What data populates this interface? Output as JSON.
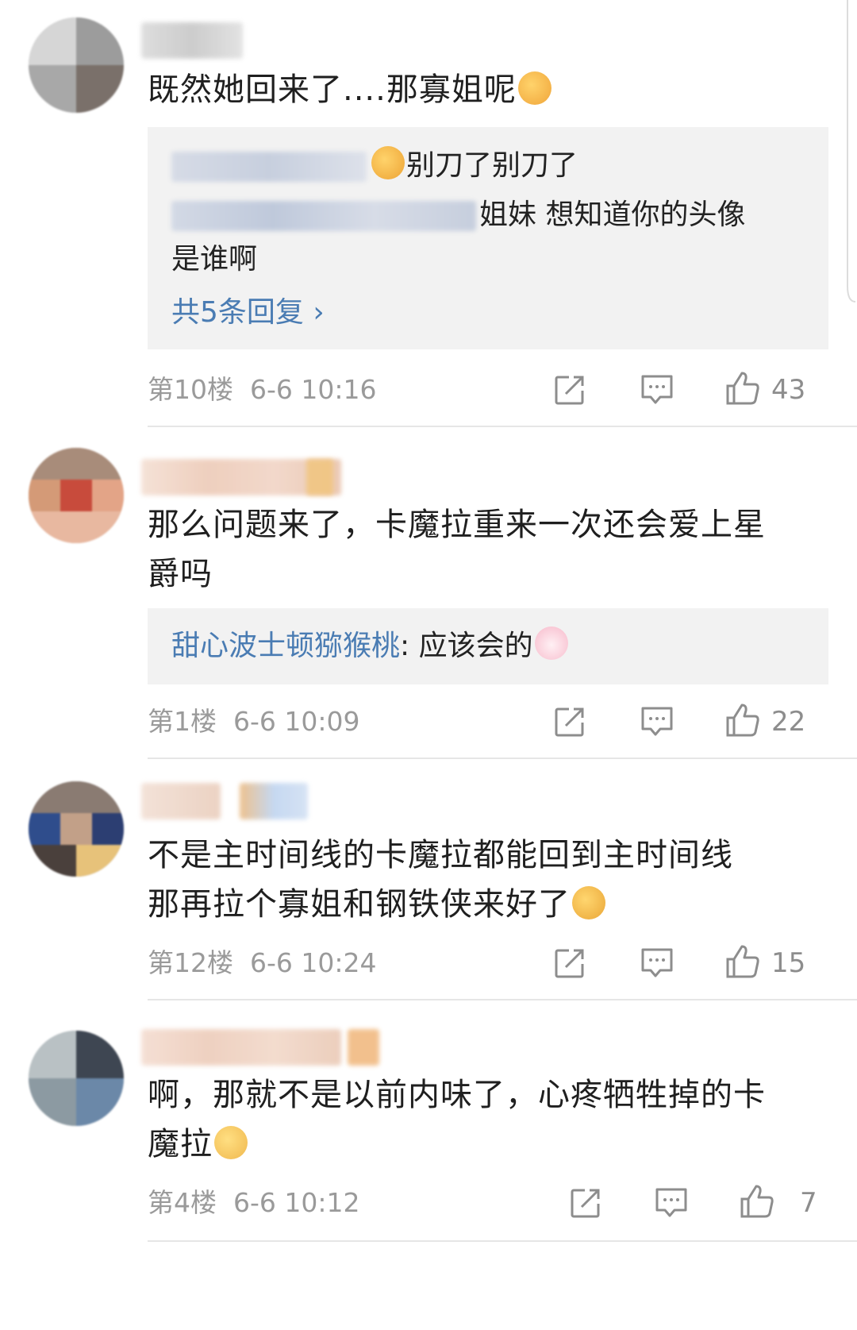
{
  "comments": [
    {
      "text": "既然她回来了....那寡姐呢",
      "replies": {
        "line1_text": "别刀了别刀了",
        "line2_text": "姐妹 想知道你的头像",
        "line3_text": "是谁啊",
        "more": "共5条回复 ›"
      },
      "floor": "第10楼",
      "time": "6-6 10:16",
      "likes": "43"
    },
    {
      "text_line1": "那么问题来了，卡魔拉重来一次还会爱上星",
      "text_line2": "爵吗",
      "reply_name": "甜心波士顿猕猴桃",
      "reply_text": ": 应该会的",
      "floor": "第1楼",
      "time": "6-6 10:09",
      "likes": "22"
    },
    {
      "text_line1": "不是主时间线的卡魔拉都能回到主时间线",
      "text_line2": "那再拉个寡姐和钢铁侠来好了",
      "floor": "第12楼",
      "time": "6-6 10:24",
      "likes": "15"
    },
    {
      "text_line1": "啊，那就不是以前内味了，心疼牺牲掉的卡",
      "text_line2": "魔拉",
      "floor": "第4楼",
      "time": "6-6 10:12",
      "likes": "7"
    }
  ],
  "icons": {
    "forward": "forward-icon",
    "comment": "comment-icon",
    "like": "thumbs-up-icon"
  },
  "colors": {
    "link": "#4a7cb3",
    "meta": "#9a9a9a",
    "reply_bg": "#f2f2f2"
  }
}
